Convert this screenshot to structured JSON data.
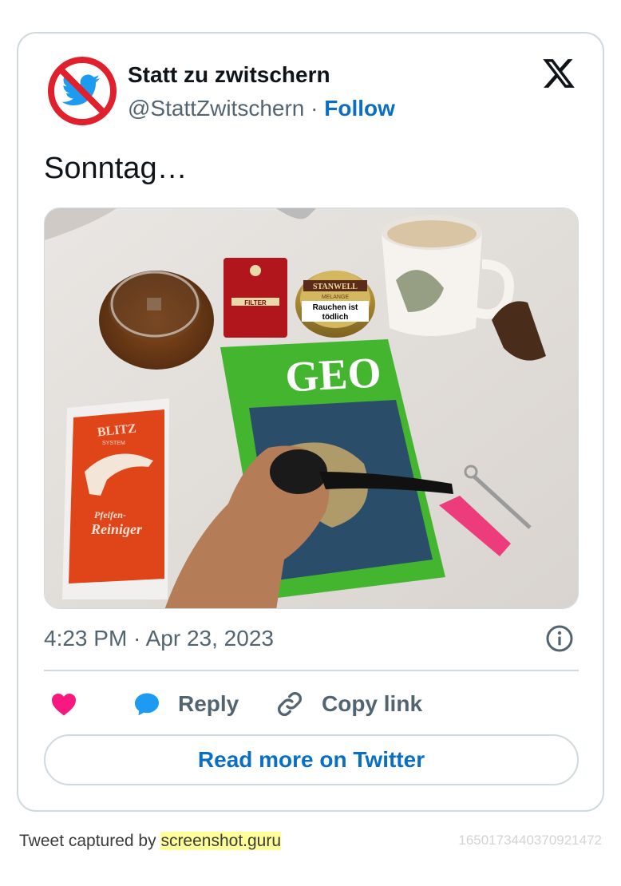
{
  "author": {
    "name": "Statt zu zwitschern",
    "handle": "@StattZwitschern",
    "separator": " · ",
    "follow_label": "Follow",
    "avatar_icon": "no-twitter-bird-icon"
  },
  "tweet": {
    "text": "Sonntag…",
    "timestamp": "4:23 PM · Apr 23, 2023"
  },
  "photo": {
    "products": {
      "blitz_brand": "BLITZ",
      "blitz_system": "SYSTEM",
      "blitz_line1": "Pfeifen-",
      "blitz_line2": "Reiniger",
      "magazine_title": "GEO",
      "tin_brand": "STANWELL",
      "tin_sub": "MELANGE",
      "tin_warning1": "Rauchen ist",
      "tin_warning2": "tödlich",
      "red_pack_label": "FILTER"
    }
  },
  "actions": {
    "like_icon": "heart-icon",
    "reply_label": "Reply",
    "copy_label": "Copy link",
    "read_more_label": "Read more on Twitter"
  },
  "footer": {
    "captured_prefix": "Tweet captured by ",
    "captured_site": "screenshot.guru",
    "tweet_id": "1650173440370921472"
  },
  "colors": {
    "link": "#0a6ec2",
    "secondary_text": "#536471",
    "border": "#cfd9de",
    "heart": "#f91880",
    "reply_bubble": "#1d9bf0",
    "no_sign_red": "#e0202d",
    "twitter_blue": "#1d9bf0"
  }
}
